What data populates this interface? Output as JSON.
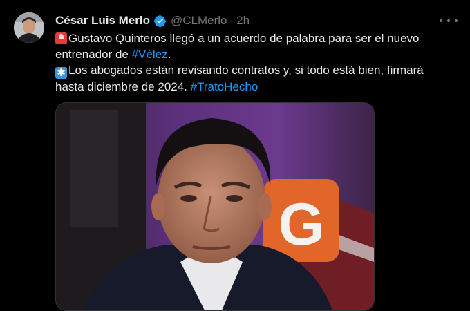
{
  "author": {
    "name": "César Luis Merlo",
    "handle": "@CLMerlo",
    "separator": "·",
    "time": "2h"
  },
  "tweet": {
    "line1_text": "Gustavo Quinteros llegó a un acuerdo de palabra para ser el nuevo",
    "line2_text": "entrenador de ",
    "hashtag_velez": "#Vélez",
    "line2_end": ".",
    "line3_text": "Los abogados están revisando contratos y, si todo está bien, firmará",
    "line4_text": "hasta diciembre de 2024. ",
    "hashtag_trato": "#TratoHecho"
  },
  "icons": {
    "verified": "verified-badge-icon",
    "more": "more-options-icon",
    "emoji1": "police-siren-emoji",
    "emoji2": "asterisk-emoji"
  },
  "image": {
    "overlay_letter": "G"
  },
  "colors": {
    "background": "#000000",
    "text": "#e7e9ea",
    "muted": "#71767b",
    "link": "#1d9bf0"
  }
}
